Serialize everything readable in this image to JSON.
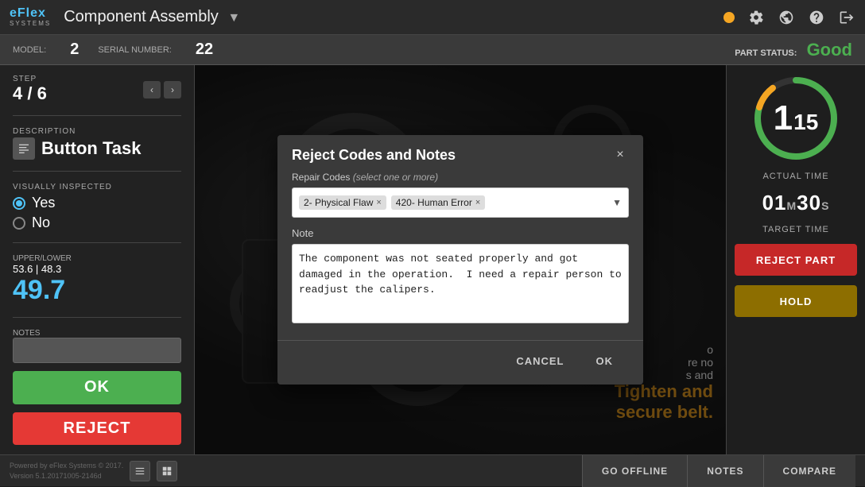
{
  "app": {
    "logo_eflex": "eFlex",
    "logo_systems": "SYSTEMS",
    "title": "Component Assembly",
    "title_dropdown_icon": "▼"
  },
  "header_icons": {
    "status_dot_color": "#f5a623",
    "gear": "⚙",
    "globe": "🌐",
    "help": "?",
    "logout": "⎋"
  },
  "info_bar": {
    "model_label": "MODEL:",
    "model_value": "2",
    "serial_label": "SERIAL NUMBER:",
    "serial_value": "22",
    "part_status_label": "PART STATUS:",
    "part_status_value": "Good"
  },
  "left_panel": {
    "step_label": "STEP",
    "step_value": "4 / 6",
    "nav_prev": "‹",
    "nav_next": "›",
    "description_label": "DESCRIPTION",
    "task_name": "Button Task",
    "visually_inspected_label": "VISUALLY INSPECTED",
    "yes_label": "Yes",
    "no_label": "No",
    "yes_selected": true,
    "upper_lower_label": "UPPER/LOWER",
    "upper_lower_values": "53.6 | 48.3",
    "measurement": "49.7",
    "notes_label": "NOTES",
    "ok_button": "OK",
    "reject_button": "REJECT"
  },
  "right_panel": {
    "timer_big": "1",
    "timer_small": "15",
    "actual_time_label": "ACTUAL TIME",
    "actual_minutes": "01",
    "actual_minutes_unit": "M",
    "actual_seconds": "30",
    "actual_seconds_unit": "S",
    "target_time_label": "TARGET TIME",
    "reject_part_btn": "REJECT PART",
    "hold_btn": "HOLD"
  },
  "engine_overlay": {
    "line1": "o",
    "line2": "re no",
    "line3": "s and",
    "line4": "Tighten and",
    "line5": "secure belt."
  },
  "bottom_bar": {
    "powered_by": "Powered by eFlex Systems © 2017.",
    "version": "Version 5.1.20171005-2146d",
    "go_offline": "GO OFFLINE",
    "notes": "NOTES",
    "compare": "COMPARE"
  },
  "modal": {
    "title": "Reject Codes and Notes",
    "close_icon": "×",
    "repair_codes_label": "Repair Codes",
    "repair_codes_hint": "(select one or more)",
    "code1": "2- Physical Flaw",
    "code2": "420- Human Error",
    "note_label": "Note",
    "note_value": "The component was not seated properly and got damaged in the operation.  I need a repair person to readjust the calipers.",
    "cancel_btn": "CANCEL",
    "ok_btn": "OK"
  }
}
